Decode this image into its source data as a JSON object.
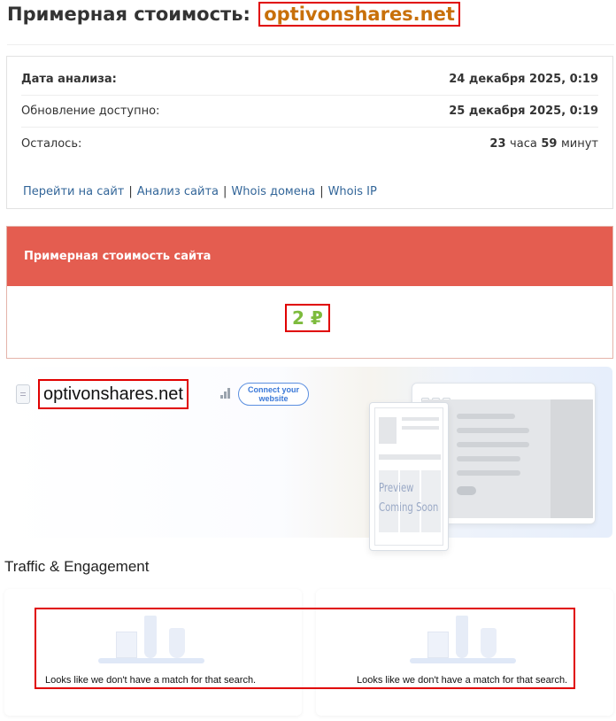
{
  "header": {
    "title_prefix": "Примерная стоимость:",
    "domain": "optivonshares.net"
  },
  "info": {
    "rows": [
      {
        "label": "Дата анализа:",
        "value": "24 декабря 2025, 0:19"
      },
      {
        "label": "Обновление доступно:",
        "value": "25 декабря 2025, 0:19"
      },
      {
        "label": "Осталось:",
        "hours_num": "23",
        "hours_unit": "часа",
        "minutes_num": "59",
        "minutes_unit": "минут"
      }
    ],
    "links": [
      "Перейти на сайт",
      "Анализ сайта",
      "Whois домена",
      "Whois IP"
    ],
    "separator": "|"
  },
  "value_card": {
    "header": "Примерная стоимость сайта",
    "price": "2 ₽"
  },
  "similarweb": {
    "domain": "optivonshares.net",
    "connect_button": "Connect your website",
    "preview_text_line1": "Preview",
    "preview_text_line2": "Coming Soon"
  },
  "traffic": {
    "section_title": "Traffic & Engagement",
    "cards": [
      {
        "message": "Looks like we don't have a match for that search."
      },
      {
        "message": "Looks like we don't have a match for that search."
      }
    ]
  },
  "colors": {
    "domain_accent": "#c8700a",
    "value_header_bg": "#e45d50",
    "price_green": "#7dbb3d",
    "link_blue": "#336699",
    "highlight_red": "#e00000"
  },
  "icons": [
    "document-icon",
    "bar-chart-icon",
    "lab-illustration-icon"
  ]
}
